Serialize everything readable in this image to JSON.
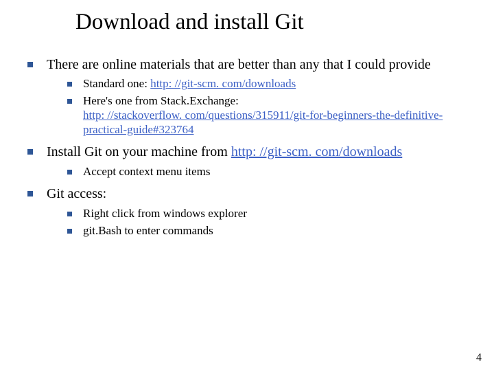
{
  "title": "Download and install Git",
  "bullets": {
    "item1": {
      "text": "There are online materials that are better than any that I could provide",
      "sub1_prefix": "Standard one:  ",
      "sub1_link": "http: //git-scm. com/downloads",
      "sub2_prefix": "Here's one from Stack.Exchange: ",
      "sub2_link": "http: //stackoverflow. com/questions/315911/git-for-beginners-the-definitive-practical-guide#323764"
    },
    "item2": {
      "text_prefix": "Install Git on your machine from ",
      "link": "http: //git-scm. com/downloads",
      "sub1": "Accept context menu items"
    },
    "item3": {
      "text": "Git access:",
      "sub1": "Right click from windows explorer",
      "sub2": "git.Bash to enter commands"
    }
  },
  "page_number": "4"
}
